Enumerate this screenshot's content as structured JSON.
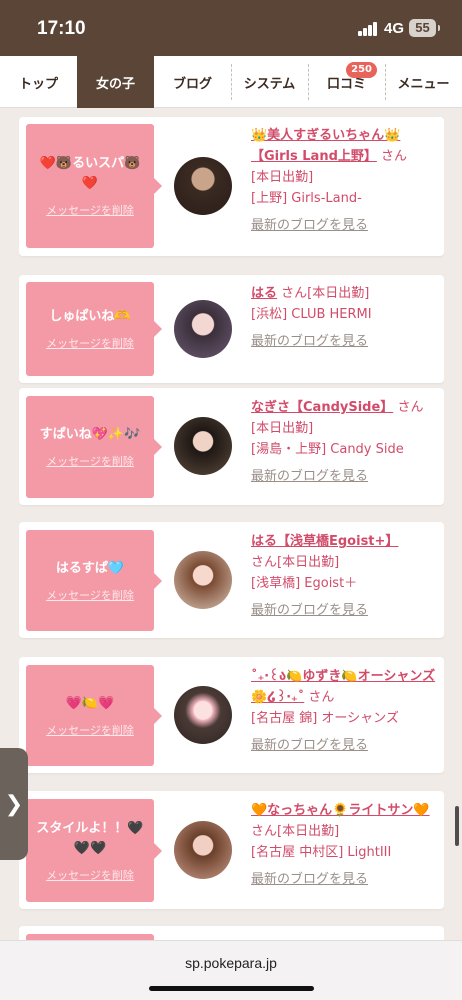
{
  "status_bar": {
    "time": "17:10",
    "network": "4G",
    "battery": "55"
  },
  "nav": {
    "tabs": [
      {
        "label": "トップ"
      },
      {
        "label": "女の子"
      },
      {
        "label": "ブログ"
      },
      {
        "label": "システム"
      },
      {
        "label": "口コミ",
        "badge": "250"
      },
      {
        "label": "メニュー"
      }
    ]
  },
  "cards": [
    {
      "message": "❤️🐻るいスパ🐻❤️",
      "delete_label": "メッセージを削除",
      "name": "👑美人すぎるいちゃん👑【Girls Land上野】",
      "suffix": "さん",
      "status": "[本日出勤]",
      "shop": "[上野] Girls-Land-",
      "blog_link": "最新のブログを見る"
    },
    {
      "message": "しゅぱいね🫶",
      "delete_label": "メッセージを削除",
      "name": "はる",
      "suffix": "さん",
      "status": "[本日出勤]",
      "shop": "[浜松] CLUB HERMI",
      "blog_link": "最新のブログを見る"
    },
    {
      "message": "すぱいね💖✨🎶",
      "delete_label": "メッセージを削除",
      "name": "なぎさ【CandySide】",
      "suffix": "さん",
      "status": "[本日出勤]",
      "shop": "[湯島・上野] Candy Side",
      "blog_link": "最新のブログを見る"
    },
    {
      "message": "はるすぱ🩵",
      "delete_label": "メッセージを削除",
      "name": "はる【浅草橋Egoist+】",
      "suffix": "さん",
      "status": "[本日出勤]",
      "shop": "[浅草橋] Egoist＋",
      "blog_link": "最新のブログを見る"
    },
    {
      "message": "💗🍋💗",
      "delete_label": "メッセージを削除",
      "name": "˚₊‧꒰ა🍋ゆずき🍋オーシャンズ🌼໒꒱‧₊˚",
      "suffix": "さん",
      "status": "",
      "shop": "[名古屋 錦] オーシャンズ",
      "blog_link": "最新のブログを見る"
    },
    {
      "message": "スタイルよ！！🖤🖤🖤",
      "delete_label": "メッセージを削除",
      "name": "🧡なっちゃん🌻ライトサン🧡",
      "suffix": "さん",
      "status": "[本日出勤]",
      "shop": "[名古屋 中村区] LightIII",
      "blog_link": "最新のブログを見る"
    }
  ],
  "side_tab": "❯",
  "url_bar": {
    "url": "sp.pokepara.jp"
  }
}
